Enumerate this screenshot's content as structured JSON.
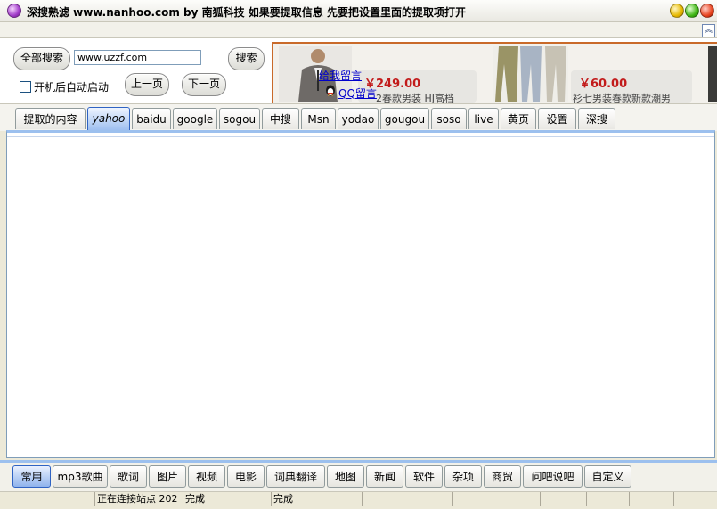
{
  "window": {
    "title": "深搜熟滤  www.nanhoo.com by 南狐科技 如果要提取信息 先要把设置里面的提取项打开"
  },
  "controls": {
    "all_search_label": "全部搜索",
    "url_value": "www.uzzf.com",
    "search_label": "搜索",
    "autostart_label": "开机后自动启动",
    "prev_label": "上一页",
    "next_label": "下一页"
  },
  "ad": {
    "message_link": "给我留言",
    "qq_link": "QQ留言",
    "card1": {
      "price": "￥249.00",
      "desc": "2春款男装 HJ高档"
    },
    "card2": {
      "price": "￥60.00",
      "desc": "衫七男装春款新款潮男"
    }
  },
  "tabs": [
    {
      "label": "提取的内容",
      "active": false
    },
    {
      "label": "yahoo",
      "active": true
    },
    {
      "label": "baidu",
      "active": false
    },
    {
      "label": "google",
      "active": false
    },
    {
      "label": "sogou",
      "active": false
    },
    {
      "label": "中搜",
      "active": false
    },
    {
      "label": "Msn",
      "active": false
    },
    {
      "label": "yodao",
      "active": false
    },
    {
      "label": "gougou",
      "active": false
    },
    {
      "label": "soso",
      "active": false
    },
    {
      "label": "live",
      "active": false
    },
    {
      "label": "黄页",
      "active": false
    },
    {
      "label": "设置",
      "active": false
    },
    {
      "label": "深搜",
      "active": false
    }
  ],
  "bottom_tabs": [
    {
      "label": "常用",
      "active": true
    },
    {
      "label": "mp3歌曲",
      "active": false
    },
    {
      "label": "歌词",
      "active": false
    },
    {
      "label": "图片",
      "active": false
    },
    {
      "label": "视频",
      "active": false
    },
    {
      "label": "电影",
      "active": false
    },
    {
      "label": "词典翻译",
      "active": false
    },
    {
      "label": "地图",
      "active": false
    },
    {
      "label": "新闻",
      "active": false
    },
    {
      "label": "软件",
      "active": false
    },
    {
      "label": "杂项",
      "active": false
    },
    {
      "label": "商贸",
      "active": false
    },
    {
      "label": "问吧说吧",
      "active": false
    },
    {
      "label": "自定义",
      "active": false
    }
  ],
  "status": {
    "connecting": "正在连接站点 202",
    "done1": "完成",
    "done2": "完成"
  },
  "colors": {
    "accent": "#2f63c3",
    "price": "#c21b1b",
    "ad_border": "#c96a2a"
  }
}
